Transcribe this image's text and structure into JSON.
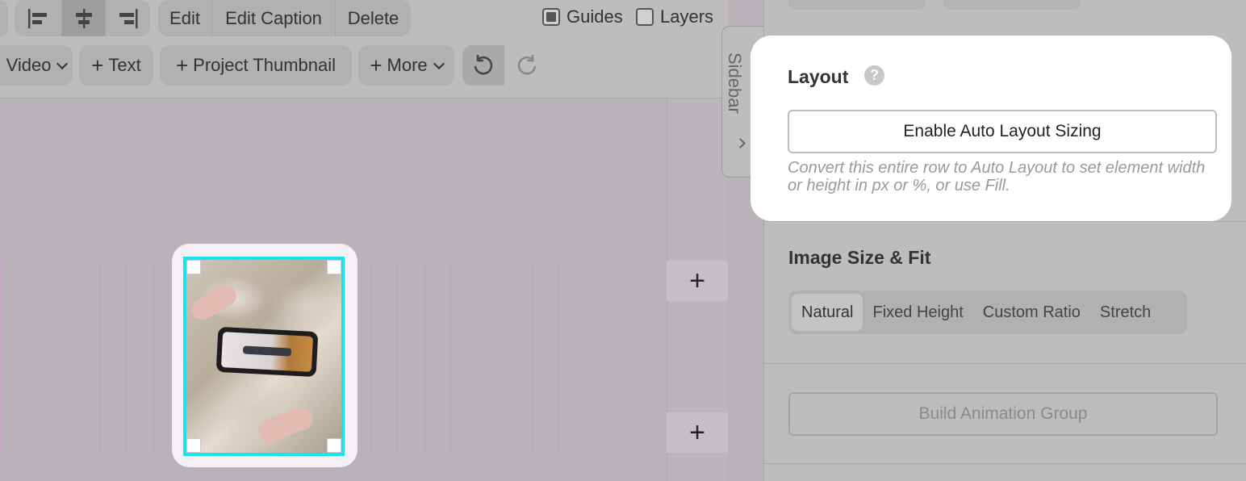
{
  "toolbar": {
    "row1": {
      "align_left_icon": "align-left-icon",
      "align_center_icon": "align-center-icon",
      "align_right_icon": "align-right-icon",
      "edit_label": "Edit",
      "edit_caption_label": "Edit Caption",
      "delete_label": "Delete",
      "guides_label": "Guides",
      "guides_checked": true,
      "layers_label": "Layers",
      "layers_checked": false
    },
    "row2": {
      "video_label": "Video",
      "text_label": "Text",
      "project_thumbnail_label": "Project Thumbnail",
      "more_label": "More",
      "undo_icon": "undo-icon",
      "redo_icon": "redo-icon"
    }
  },
  "sidebar_tab": {
    "label": "Sidebar"
  },
  "panel": {
    "layout": {
      "title": "Layout",
      "help_glyph": "?",
      "button_label": "Enable Auto Layout Sizing",
      "help_text": "Convert this entire row to Auto Layout to set element width or height in px or %, or use Fill."
    },
    "image_size": {
      "title": "Image Size & Fit",
      "options": [
        "Natural",
        "Fixed Height",
        "Custom Ratio",
        "Stretch"
      ],
      "selected": "Natural"
    },
    "build_animation_label": "Build Animation Group"
  },
  "canvas": {
    "add_row_glyph": "+"
  },
  "colors": {
    "selection": "#18e3ef",
    "highlight_card": "#ffffff",
    "gridline": "#86c3c1"
  }
}
